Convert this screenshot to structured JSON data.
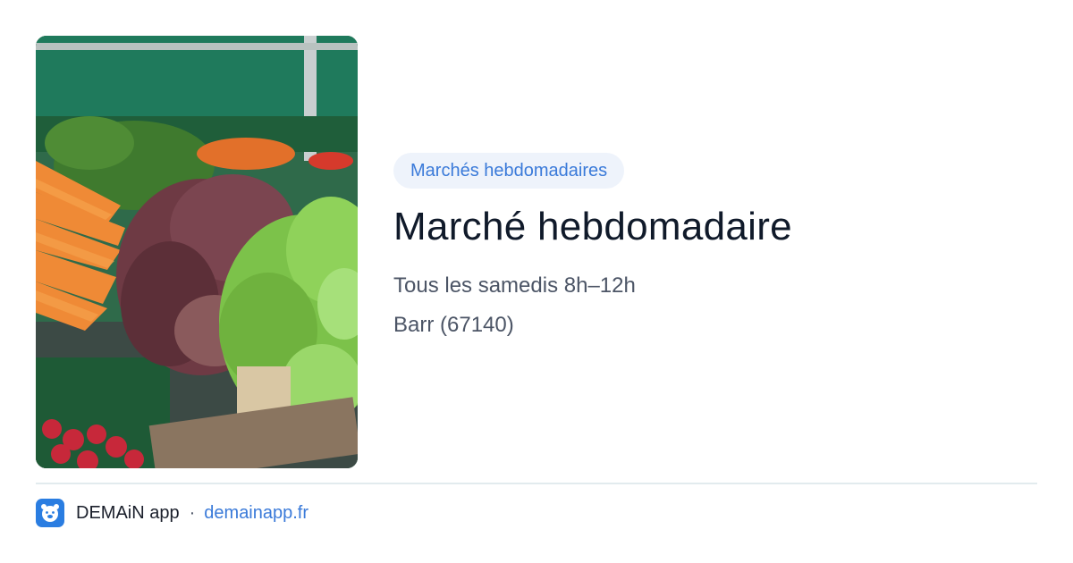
{
  "event": {
    "category": "Marchés hebdomadaires",
    "title": "Marché hebdomadaire",
    "schedule": "Tous les samedis 8h–12h",
    "location": "Barr (67140)"
  },
  "footer": {
    "app_name": "DEMAiN app",
    "separator": "·",
    "url": "demainapp.fr"
  },
  "icons": {
    "app_logo": "bear-face-icon"
  },
  "colors": {
    "accent": "#3a7ad9",
    "badge_bg": "#eef3fb",
    "title": "#101a2a",
    "muted": "#4c5566",
    "divider": "#e2ebee",
    "logo_bg": "#2a7de1"
  }
}
